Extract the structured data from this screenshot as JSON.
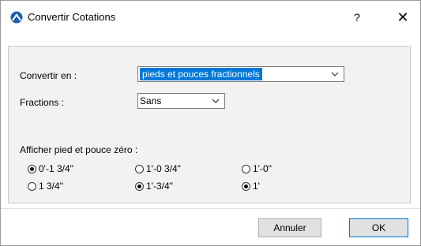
{
  "window": {
    "title": "Convertir Cotations",
    "help": "?",
    "close": "✕"
  },
  "convert_to": {
    "label": "Convertir en :",
    "value": "pieds et pouces fractionnels"
  },
  "fractions": {
    "label": "Fractions :",
    "value": "Sans"
  },
  "zero_display": {
    "label": "Afficher pied et pouce zéro :",
    "options": [
      {
        "label": "0'-1 3/4\"",
        "checked": true
      },
      {
        "label": "1'-0 3/4\"",
        "checked": false
      },
      {
        "label": "1'-0\"",
        "checked": false
      },
      {
        "label": "1 3/4\"",
        "checked": false
      },
      {
        "label": "1'-3/4\"",
        "checked": true
      },
      {
        "label": "1'",
        "checked": true
      }
    ]
  },
  "buttons": {
    "cancel": "Annuler",
    "ok": "OK"
  },
  "colors": {
    "accent": "#0078d7"
  }
}
